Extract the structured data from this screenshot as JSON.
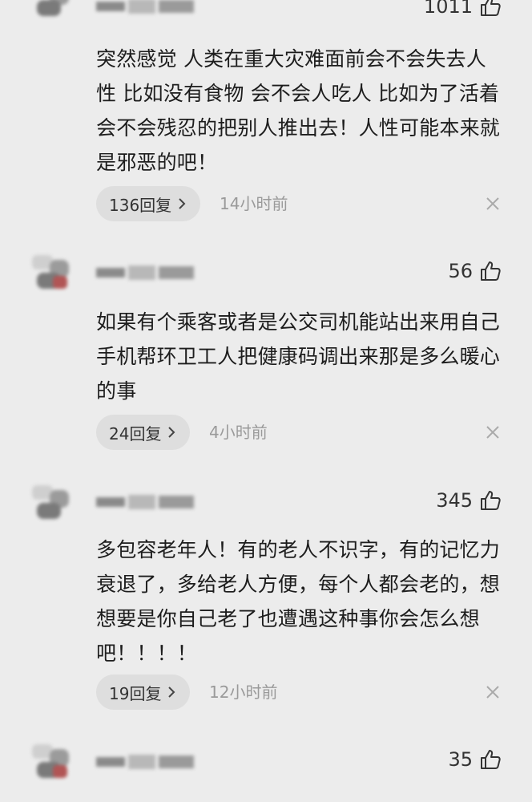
{
  "comments": [
    {
      "likes": "1011",
      "text": "突然感觉 人类在重大灾难面前会不会失去人性 比如没有食物 会不会人吃人 比如为了活着 会不会残忍的把别人推出去！人性可能本来就是邪恶的吧！",
      "replies": "136回复",
      "time": "14小时前"
    },
    {
      "likes": "56",
      "text": "如果有个乘客或者是公交司机能站出来用自己手机帮环卫工人把健康码调出来那是多么暖心的事",
      "replies": "24回复",
      "time": "4小时前"
    },
    {
      "likes": "345",
      "text": "多包容老年人！有的老人不识字，有的记忆力衰退了，多给老人方便，每个人都会老的，想想要是你自己老了也遭遇这种事你会怎么想吧！！！！",
      "replies": "19回复",
      "time": "12小时前"
    },
    {
      "likes": "35"
    }
  ],
  "icons": {
    "like": "thumbs-up-icon",
    "dismiss": "close-icon",
    "reply_more": "chevron-right-icon"
  },
  "colors": {
    "background": "#ececec",
    "reply_pill": "#dedede",
    "meta_text": "#9a9a9a"
  }
}
